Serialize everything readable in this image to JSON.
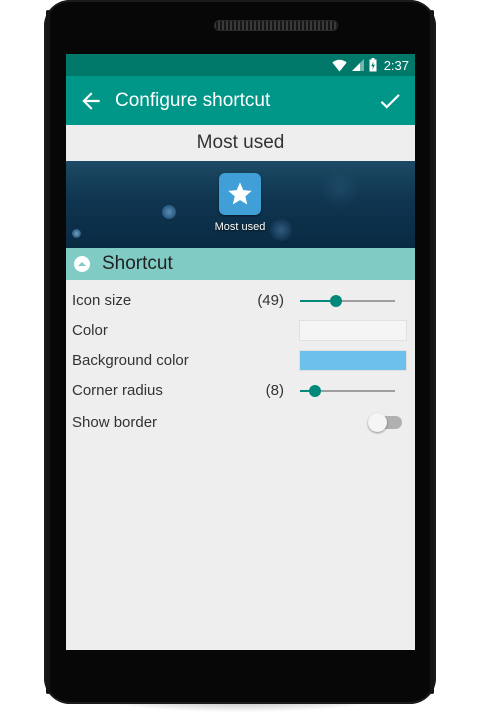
{
  "status_bar": {
    "time": "2:37",
    "icons": [
      "wifi-icon",
      "cell-signal-icon",
      "battery-charging-icon"
    ]
  },
  "app_bar": {
    "title": "Configure shortcut",
    "back_icon": "arrow-back-icon",
    "confirm_icon": "check-icon",
    "color": "#009688",
    "status_color": "#00796b"
  },
  "preview": {
    "title": "Most used",
    "shortcut_label": "Most used",
    "shortcut_icon": "star-icon",
    "icon_color": "#3f9fd6"
  },
  "section": {
    "title": "Shortcut",
    "icon": "chevron-up-circle-icon",
    "color": "#80cbc4"
  },
  "settings": {
    "icon_size": {
      "label": "Icon size",
      "value_text": "(49)",
      "value": 49,
      "min": 0,
      "max": 130
    },
    "color": {
      "label": "Color",
      "value": "#f5f5f5"
    },
    "background_color": {
      "label": "Background color",
      "value": "#6ec0ec"
    },
    "corner_radius": {
      "label": "Corner radius",
      "value_text": "(8)",
      "value": 8,
      "min": 0,
      "max": 50
    },
    "show_border": {
      "label": "Show border",
      "enabled": false
    }
  },
  "accent_color": "#00897b"
}
